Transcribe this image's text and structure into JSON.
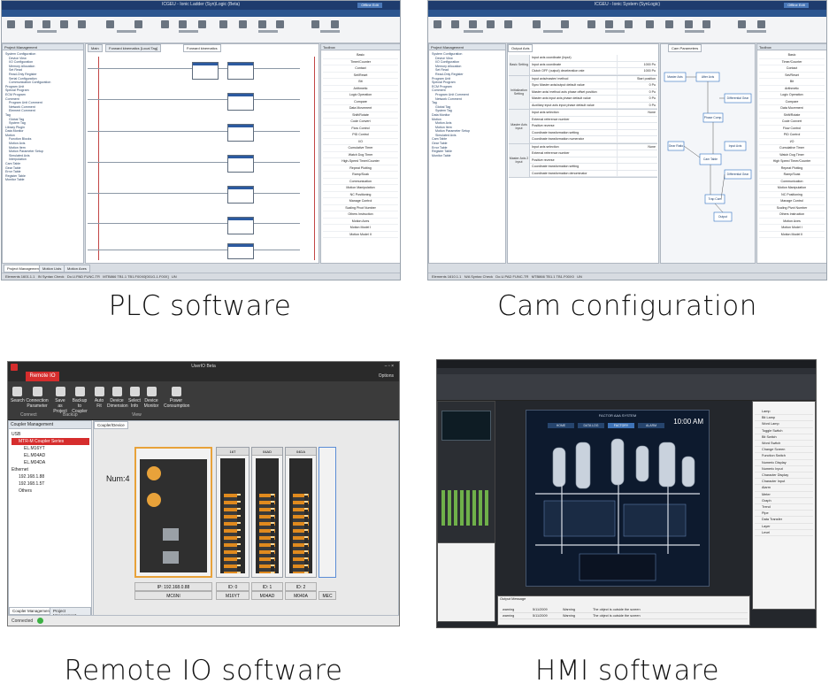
{
  "captions": {
    "plc": "PLC software",
    "cam": "Cam configuration",
    "rio": "Remote IO software",
    "hmi": "HMI software"
  },
  "plc": {
    "title": "ICGEU - Ionic Ladder (Syn)Logic (Beta)",
    "offline": "Offline Edit",
    "menu": [
      "Project",
      "Designer",
      "PLC",
      "View",
      "Tools"
    ],
    "pane_title": "Project Management",
    "tabs": [
      "Main",
      "Forward kinematics [Local Tag]",
      "Forward kinematics"
    ],
    "tree": [
      "System Configuration",
      "Device View",
      "I/O Configuration",
      "Memory Allocation",
      "Set Read",
      "Read-Only Register",
      "Serial Configuration",
      "Communication Configuration",
      "Program Unit",
      "Special Program",
      "ECM Program",
      "Comment",
      "Program Unit Comment",
      "Network Comment",
      "Element Comment",
      "Tag",
      "Global Tag",
      "System Tag",
      "Library Plugin",
      "Data Monitor",
      "Motion",
      "Function Blocks",
      "Motion Axis",
      "Motion Item",
      "Motion Parameter Setup",
      "Simulated Axis",
      "Interpolation",
      "Cam Table",
      "Gear Table",
      "Error Table",
      "Register Table",
      "Monitor Table"
    ],
    "toolbox_title": "Toolbox",
    "toolbox": [
      "Basic",
      "Timer/Counter",
      "Contact",
      "Set/Reset",
      "Bit",
      "Arithmetic",
      "Logic Operation",
      "Compare",
      "Data Movement",
      "Shift/Rotate",
      "Code Convert",
      "Flow Control",
      "PID Control",
      "I/O",
      "Cumulative Timer",
      "Watch Dog Timer",
      "High-Speed Timer/Counter",
      "Repeat Plotting",
      "Ramp/Soak",
      "Communication",
      "Motion Manipulation",
      "NC Positioning",
      "Manage Control",
      "Scaling Pivot Number",
      "Others Instruction",
      "Motion Axes",
      "Motion Model I",
      "Motion Model II"
    ],
    "status": [
      "Elements 1601.1.1",
      "IN Syntax Check",
      "Do.U.PAD FUNC-TR",
      "MTB866 TB1.1 TB1.F00X0[001G-1.F00X]",
      "UN"
    ],
    "bottom_tabs": [
      "Project Management",
      "Motion Lists",
      "Motion Axes"
    ]
  },
  "cam": {
    "title": "ICGEU - Ionic System (SynLogic)",
    "offline": "Offline Edit",
    "menu": [
      "Project",
      "Designer",
      "PLC",
      "View",
      "Tools"
    ],
    "pane_title": "Project Management",
    "tabs": [
      "Forward kinematics [Local Tag]",
      "Forward kinematics",
      "Motion Axis",
      "Motion Axis",
      "Cam Parameters",
      "Inhibitor Network"
    ],
    "output_axis": "Output Axis",
    "groups": [
      {
        "name": "Basic Setting",
        "rows": [
          [
            "Input axis coordinate (Input)",
            ""
          ],
          [
            "Input axis coordinate",
            "1000 Pu"
          ],
          [
            "Clutch OFF (output) deceleration rate",
            "1000 Pu"
          ]
        ]
      },
      {
        "name": "Initialization Setting",
        "rows": [
          [
            "Input axis/master/ method",
            "Start position"
          ],
          [
            "Sync Master axis/output default value",
            "0 Pu"
          ],
          [
            "Master axis/ method axis phase offset position",
            "0 Pu"
          ],
          [
            "Master axis input axis phase default value",
            "0 Pu"
          ],
          [
            "Auxiliary input axis input phase default value",
            "0 Pu"
          ]
        ]
      },
      {
        "name": "Master Axis Input",
        "rows": [
          [
            "Input axis selection",
            "None"
          ],
          [
            "External reference number",
            ""
          ],
          [
            "Positive reverse",
            ""
          ],
          [
            "Coordinate transformation setting",
            ""
          ],
          [
            "Coordinate transformation numerator",
            ""
          ]
        ]
      },
      {
        "name": "Master Axis 2 Input",
        "rows": [
          [
            "Input axis selection",
            "None"
          ],
          [
            "External reference number",
            ""
          ],
          [
            "Positive reverse",
            ""
          ],
          [
            "Coordinate transformation setting",
            ""
          ],
          [
            "Coordinate transformation denominator",
            ""
          ]
        ]
      }
    ],
    "diagram_labels": [
      "Master Axis",
      "After Axis",
      "Differential Gear",
      "Phase Comp.",
      "Gear Ratio",
      "Input Axis",
      "Cam Table",
      "Differential Gear",
      "Trap Cam",
      "Output"
    ],
    "toolbox": [
      "Basic",
      "Timer/Counter",
      "Contact",
      "Set/Reset",
      "Bit",
      "Arithmetic",
      "Logic Operation",
      "Compare",
      "Data Movement",
      "Shift/Rotate",
      "Code Convert",
      "Flow Control",
      "PID Control",
      "I/O",
      "Cumulative Timer",
      "Watch Dog Timer",
      "High Speed Timer/Counter",
      "Repeat Plotting",
      "Ramp/Soak",
      "Communication",
      "Motion Manipulation",
      "NC Positioning",
      "Manage Control",
      "Scaling Pivot Number",
      "Others Instruction",
      "Motion Axes",
      "Motion Model I",
      "Motion Model II"
    ],
    "status": [
      "Elements 1610.1.1",
      "N/A Syntax Check",
      "Do.U.PAD FUNC-TR",
      "MTB866 TB1.1 TB1.F00X0",
      "UN"
    ]
  },
  "rio": {
    "title": "UserIO Beta",
    "tab": "Remote IO",
    "options": "Options",
    "ribbon": [
      {
        "label": "Search",
        "group": "Connect"
      },
      {
        "label": "Connection Parameter",
        "group": "Connect"
      },
      {
        "label": "Save as Project",
        "group": "Backup"
      },
      {
        "label": "Backup to Coupler",
        "group": "Backup"
      },
      {
        "label": "Auto Fit",
        "group": "View"
      },
      {
        "label": "Device Dimension",
        "group": "View"
      },
      {
        "label": "Select Info",
        "group": "View"
      },
      {
        "label": "Device Monitor",
        "group": "View"
      },
      {
        "label": "Power Consumption",
        "group": "View"
      }
    ],
    "groups": [
      "Connect",
      "Backup",
      "View"
    ],
    "pane_title": "Coupler Management",
    "tree": [
      "USB",
      "MTR-M Coupler Series",
      "EL.M16YT",
      "EL.M04AD",
      "EL.M04DA",
      "Ethernet",
      "192.168.1.88",
      "192.168.1.5T",
      "Others"
    ],
    "canvas_tab": "Coupler/Device",
    "num_label": "Num:4",
    "modules": [
      {
        "head": "",
        "label": "MC6NI",
        "ip": "IP: 192.168.0.88"
      },
      {
        "head": "16T",
        "label": "M16YT",
        "ip": "ID: 0"
      },
      {
        "head": "04AD",
        "label": "M04AD",
        "ip": "ID: 1"
      },
      {
        "head": "04DA",
        "label": "M040A",
        "ip": "ID: 2"
      },
      {
        "head": "",
        "label": "MEC",
        "ip": ""
      }
    ],
    "bottom_tabs": [
      "Coupler Management",
      "Project Management"
    ],
    "status": "Connected"
  },
  "hmi": {
    "title": "",
    "menu": [
      "File",
      "Project",
      "Insert",
      "View",
      "Tools"
    ],
    "screen_title": "FACTOR AAA SYSTEM",
    "screen_tabs": [
      "HOME",
      "DATA LOG",
      "FACTORY",
      "ALARM"
    ],
    "clock": "10:00 AM",
    "output_title": "Output Message",
    "output_rows": [
      [
        "warning",
        "5/11/2009",
        "Warning",
        "The object is outside the screen"
      ],
      [
        "warning",
        "5/11/2009",
        "Warning",
        "The object is outside the screen"
      ]
    ],
    "toolbox": [
      "Lamp",
      "Bit Lamp",
      "Word Lamp",
      "Toggle Switch",
      "Bit Switch",
      "Word Switch",
      "Change Screen",
      "Function Switch",
      "Numeric Display",
      "Numeric Input",
      "Character Display",
      "Character Input",
      "Alarm",
      "Meter",
      "Graph",
      "Trend",
      "Pipe",
      "Data Transfer",
      "Layer",
      "Level"
    ]
  },
  "colors": {
    "plc_title": "#1e3c6e",
    "rio_red": "#d62d2d",
    "orange": "#e8a23a"
  }
}
